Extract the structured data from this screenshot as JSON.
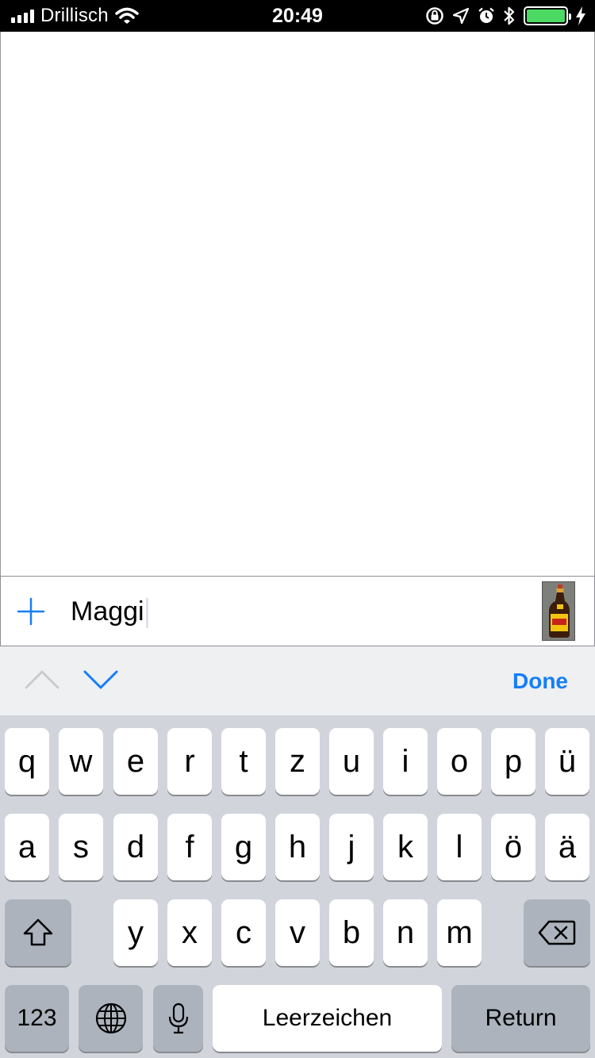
{
  "status_bar": {
    "carrier": "Drillisch",
    "time": "20:49",
    "battery_level": 1.0
  },
  "input_row": {
    "item_text": "Maggi",
    "add_icon": "plus-icon",
    "thumbnail": "maggi-bottle-image"
  },
  "accessory_bar": {
    "done_label": "Done",
    "previous_icon": "chevron-up-icon",
    "next_icon": "chevron-down-icon"
  },
  "keyboard": {
    "row1": [
      "q",
      "w",
      "e",
      "r",
      "t",
      "z",
      "u",
      "i",
      "o",
      "p",
      "ü"
    ],
    "row2": [
      "a",
      "s",
      "d",
      "f",
      "g",
      "h",
      "j",
      "k",
      "l",
      "ö",
      "ä"
    ],
    "row3": [
      "y",
      "x",
      "c",
      "v",
      "b",
      "n",
      "m"
    ],
    "numbers_label": "123",
    "space_label": "Leerzeichen",
    "return_label": "Return"
  },
  "colors": {
    "accent": "#157efb",
    "battery": "#4cd964",
    "keyboard_bg": "#d1d5db",
    "accessory_bg": "#eff0f2"
  }
}
